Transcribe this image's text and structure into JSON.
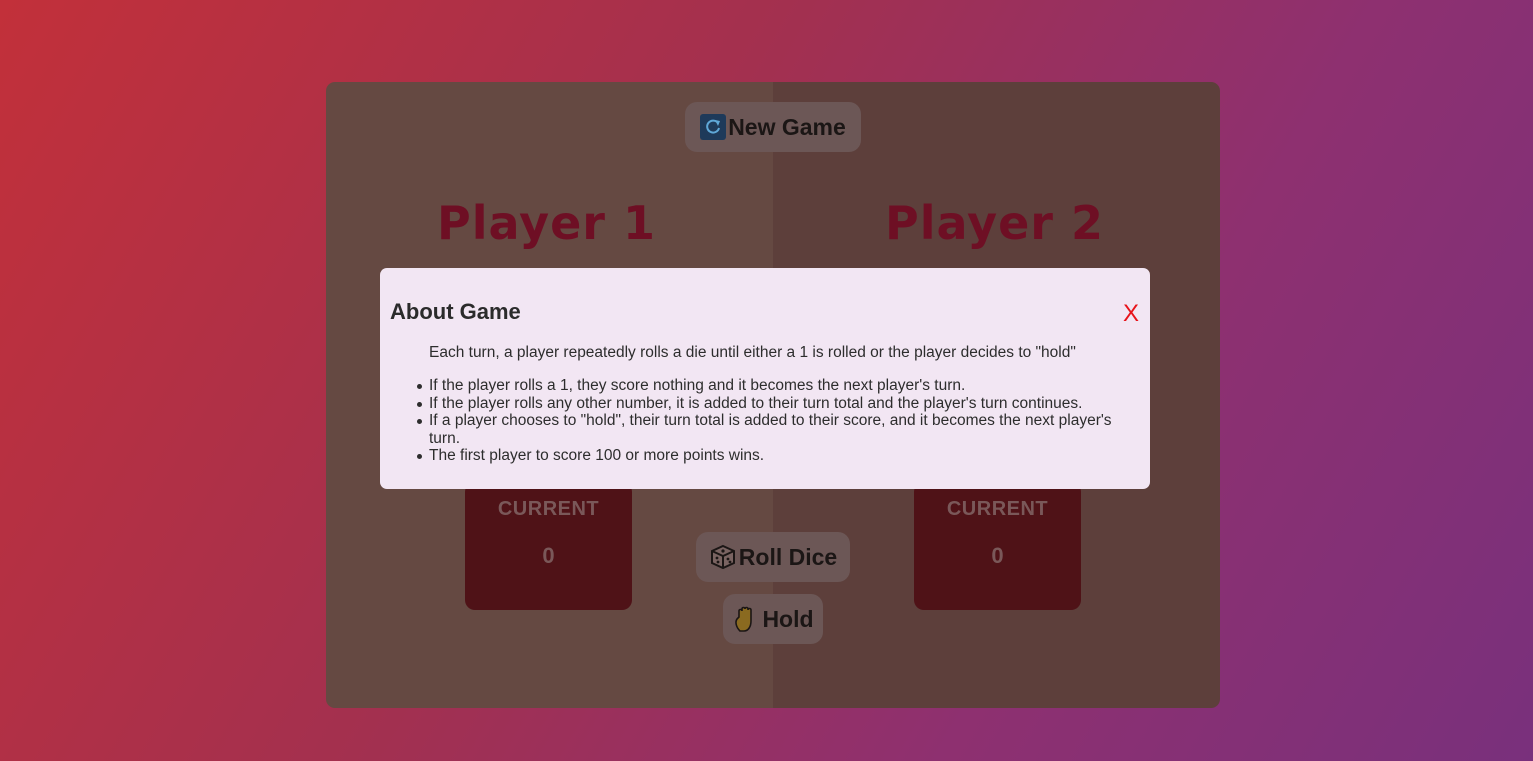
{
  "controls": {
    "new_game": "New Game",
    "roll_dice": "Roll Dice",
    "hold": "Hold"
  },
  "players": [
    {
      "name": "Player 1",
      "current_label": "CURRENT",
      "current_score": "0"
    },
    {
      "name": "Player 2",
      "current_label": "CURRENT",
      "current_score": "0"
    }
  ],
  "modal": {
    "title": "About Game",
    "close": "X",
    "intro": "Each turn, a player repeatedly rolls a die until either a 1 is rolled or the player decides to \"hold\"",
    "rules": [
      "If the player rolls a 1, they score nothing and it becomes the next player's turn.",
      "If the player rolls any other number, it is added to their turn total and the player's turn continues.",
      "If a player chooses to \"hold\", their turn total is added to their score, and it becomes the next player's turn.",
      "The first player to score 100 or more points wins."
    ]
  },
  "icons": {
    "new_game": "refresh-icon",
    "roll_dice": "dice-icon",
    "hold": "hand-icon"
  },
  "colors": {
    "player_name": "#6e0f24",
    "close": "#e8131a",
    "modal_bg": "#f2e6f3"
  }
}
